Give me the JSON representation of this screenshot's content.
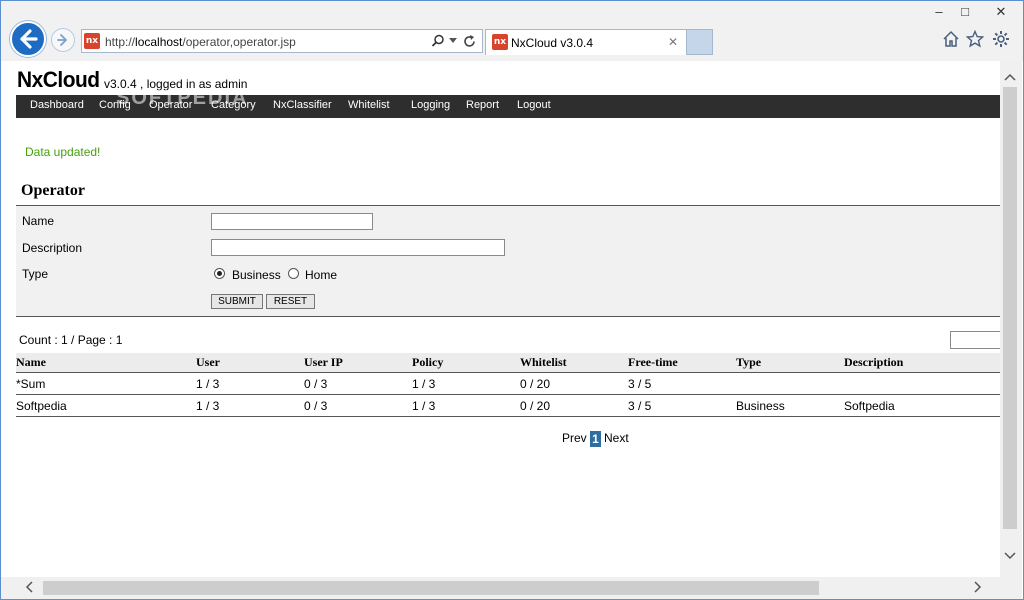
{
  "browser": {
    "url_prefix": "http://",
    "url_host": "localhost",
    "url_path": "/operator,operator.jsp",
    "tab_title": "NxCloud v3.0.4",
    "site_icon": "nx",
    "minimize": "–",
    "maximize": "□",
    "close": "✕"
  },
  "page": {
    "brand": "NxCloud",
    "brand_sub": "v3.0.4 , logged in as admin",
    "watermark": "SOFTPEDIA",
    "nav": [
      "Dashboard",
      "Config",
      "Operator",
      "Category",
      "NxClassifier",
      "Whitelist",
      "Logging",
      "Report",
      "Logout"
    ],
    "notice": "Data updated!",
    "section_title": "Operator",
    "form": {
      "name_label": "Name",
      "name_value": "",
      "description_label": "Description",
      "description_value": "",
      "type_label": "Type",
      "type_options": [
        "Business",
        "Home"
      ],
      "type_selected": "Business",
      "submit_label": "SUBMIT",
      "reset_label": "RESET"
    },
    "count_text": "Count : 1 / Page : 1",
    "table": {
      "columns": [
        "Name",
        "User",
        "User IP",
        "Policy",
        "Whitelist",
        "Free-time",
        "Type",
        "Description"
      ],
      "rows": [
        [
          "*Sum",
          "1 / 3",
          "0 / 3",
          "1 / 3",
          "0 / 20",
          "3 / 5",
          "",
          ""
        ],
        [
          "Softpedia",
          "1 / 3",
          "0 / 3",
          "1 / 3",
          "0 / 20",
          "3 / 5",
          "Business",
          "Softpedia"
        ]
      ]
    },
    "pager": {
      "prev": "Prev",
      "current": "1",
      "next": "Next"
    }
  }
}
